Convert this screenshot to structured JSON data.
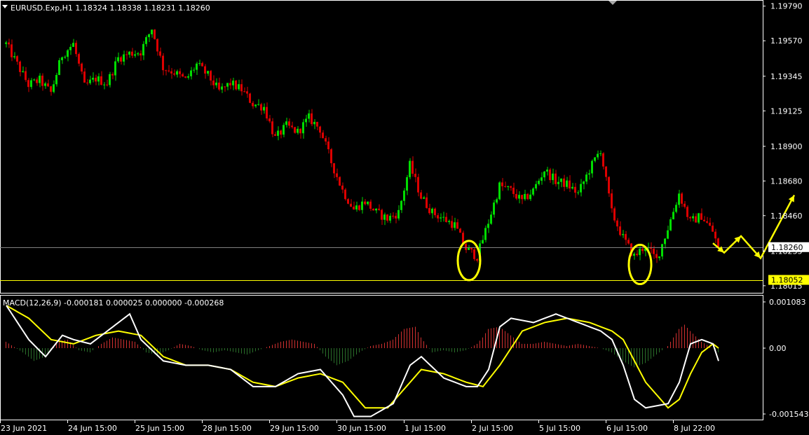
{
  "window": {
    "symbol_line": "EURUSD.Exp,H1  1.18324 1.18338 1.18231 1.18260",
    "macd_line": "MACD(12,26,9) -0.000181 0.000025 0.000000 -0.000268"
  },
  "colors": {
    "background": "#000000",
    "border": "#ffffff",
    "bull": "#00dd00",
    "bear": "#dd0000",
    "macd_main": "#ffffff",
    "macd_signal": "#ffff00",
    "hist_pos": "#d03030",
    "hist_neg": "#2a6e2a",
    "annotation": "#ffff00",
    "bid_line": "#808080",
    "support_line": "#ffff00"
  },
  "chart_data": [
    {
      "type": "candlestick",
      "title": "EURUSD.Exp,H1",
      "ohlc_last": {
        "open": 1.18324,
        "high": 1.18338,
        "low": 1.18231,
        "close": 1.1826
      },
      "ylim": [
        1.1797,
        1.1982
      ],
      "y_ticks": [
        "1.19790",
        "1.19570",
        "1.19345",
        "1.19125",
        "1.18900",
        "1.18680",
        "1.18460",
        "1.18235",
        "1.18015"
      ],
      "x_ticks": [
        "23 Jun 2021",
        "24 Jun 15:00",
        "25 Jun 15:00",
        "28 Jun 15:00",
        "29 Jun 15:00",
        "30 Jun 15:00",
        "1 Jul 15:00",
        "2 Jul 15:00",
        "5 Jul 15:00",
        "6 Jul 15:00",
        "8 Jul 22:00"
      ],
      "price_labels": {
        "bid": "1.18260",
        "support": "1.18052"
      },
      "horizontal_lines": [
        {
          "name": "bid",
          "value": 1.1826
        },
        {
          "name": "support",
          "value": 1.18052
        }
      ],
      "path": [
        [
          0,
          1.1955
        ],
        [
          4,
          1.1942
        ],
        [
          8,
          1.1929
        ],
        [
          12,
          1.1932
        ],
        [
          16,
          1.1924
        ],
        [
          20,
          1.1948
        ],
        [
          24,
          1.1955
        ],
        [
          28,
          1.1928
        ],
        [
          32,
          1.1933
        ],
        [
          36,
          1.193
        ],
        [
          40,
          1.1946
        ],
        [
          44,
          1.1949
        ],
        [
          48,
          1.195
        ],
        [
          52,
          1.1965
        ],
        [
          56,
          1.194
        ],
        [
          60,
          1.1937
        ],
        [
          64,
          1.1932
        ],
        [
          68,
          1.1942
        ],
        [
          72,
          1.1935
        ],
        [
          76,
          1.1925
        ],
        [
          80,
          1.193
        ],
        [
          84,
          1.1926
        ],
        [
          88,
          1.1917
        ],
        [
          92,
          1.1915
        ],
        [
          96,
          1.1895
        ],
        [
          100,
          1.1903
        ],
        [
          104,
          1.1899
        ],
        [
          108,
          1.1908
        ],
        [
          112,
          1.1901
        ],
        [
          116,
          1.188
        ],
        [
          120,
          1.1862
        ],
        [
          124,
          1.185
        ],
        [
          128,
          1.1855
        ],
        [
          132,
          1.1848
        ],
        [
          136,
          1.1844
        ],
        [
          140,
          1.1848
        ],
        [
          144,
          1.1878
        ],
        [
          148,
          1.1858
        ],
        [
          152,
          1.1848
        ],
        [
          156,
          1.1844
        ],
        [
          160,
          1.184
        ],
        [
          164,
          1.1825
        ],
        [
          168,
          1.182
        ],
        [
          172,
          1.1842
        ],
        [
          176,
          1.1865
        ],
        [
          180,
          1.1862
        ],
        [
          184,
          1.1855
        ],
        [
          188,
          1.1862
        ],
        [
          192,
          1.1875
        ],
        [
          196,
          1.1868
        ],
        [
          200,
          1.1866
        ],
        [
          204,
          1.186
        ],
        [
          208,
          1.1875
        ],
        [
          212,
          1.1888
        ],
        [
          216,
          1.1848
        ],
        [
          220,
          1.1832
        ],
        [
          224,
          1.182
        ],
        [
          228,
          1.1827
        ],
        [
          232,
          1.1818
        ],
        [
          236,
          1.1838
        ],
        [
          240,
          1.186
        ],
        [
          244,
          1.1842
        ],
        [
          248,
          1.1846
        ],
        [
          252,
          1.1836
        ],
        [
          254,
          1.1826
        ]
      ],
      "annotations": {
        "circles": [
          {
            "x": 165,
            "y": 1.18175
          },
          {
            "x": 226,
            "y": 1.1815
          }
        ],
        "forecast_arrows": [
          {
            "x": 252,
            "y": 1.18285
          },
          {
            "x": 256,
            "y": 1.18225
          },
          {
            "x": 262,
            "y": 1.1833
          },
          {
            "x": 269,
            "y": 1.1819
          },
          {
            "x": 281,
            "y": 1.1859
          }
        ]
      }
    },
    {
      "type": "macd",
      "title": "MACD(12,26,9)",
      "values": {
        "main": -0.000181,
        "signal": 2.5e-05,
        "histogram": 0.0,
        "extra": -0.000268
      },
      "ylim": [
        -0.001543,
        0.001083
      ],
      "y_ticks": [
        "0.001083",
        "0.00",
        "-0.001543"
      ],
      "main": [
        [
          0,
          0.001
        ],
        [
          8,
          0.0002
        ],
        [
          14,
          -0.0002
        ],
        [
          20,
          0.0003
        ],
        [
          24,
          0.0002
        ],
        [
          30,
          0.0001
        ],
        [
          36,
          0.0004
        ],
        [
          44,
          0.0008
        ],
        [
          48,
          0.0002
        ],
        [
          56,
          -0.0003
        ],
        [
          64,
          -0.0004
        ],
        [
          72,
          -0.0004
        ],
        [
          80,
          -0.0005
        ],
        [
          88,
          -0.0009
        ],
        [
          96,
          -0.0009
        ],
        [
          104,
          -0.0006
        ],
        [
          112,
          -0.0005
        ],
        [
          120,
          -0.0011
        ],
        [
          124,
          -0.0016
        ],
        [
          130,
          -0.0016
        ],
        [
          138,
          -0.0013
        ],
        [
          144,
          -0.0004
        ],
        [
          148,
          -0.0002
        ],
        [
          156,
          -0.0007
        ],
        [
          164,
          -0.0009
        ],
        [
          168,
          -0.0009
        ],
        [
          172,
          -0.0005
        ],
        [
          176,
          0.0005
        ],
        [
          180,
          0.0007
        ],
        [
          188,
          0.0006
        ],
        [
          196,
          0.0008
        ],
        [
          204,
          0.0006
        ],
        [
          212,
          0.0004
        ],
        [
          216,
          0.0002
        ],
        [
          220,
          -0.0004
        ],
        [
          224,
          -0.0012
        ],
        [
          228,
          -0.0014
        ],
        [
          236,
          -0.0013
        ],
        [
          240,
          -0.0008
        ],
        [
          244,
          0.0001
        ],
        [
          248,
          0.0002
        ],
        [
          252,
          0.0001
        ],
        [
          254,
          -0.0003
        ]
      ],
      "signal": [
        [
          0,
          0.001
        ],
        [
          8,
          0.0007
        ],
        [
          16,
          0.0002
        ],
        [
          24,
          0.0001
        ],
        [
          32,
          0.0003
        ],
        [
          40,
          0.0004
        ],
        [
          48,
          0.0003
        ],
        [
          56,
          -0.0002
        ],
        [
          64,
          -0.0004
        ],
        [
          72,
          -0.0004
        ],
        [
          80,
          -0.0005
        ],
        [
          88,
          -0.0008
        ],
        [
          96,
          -0.0009
        ],
        [
          104,
          -0.0007
        ],
        [
          112,
          -0.0006
        ],
        [
          120,
          -0.0008
        ],
        [
          128,
          -0.0014
        ],
        [
          136,
          -0.0014
        ],
        [
          140,
          -0.0011
        ],
        [
          148,
          -0.0005
        ],
        [
          156,
          -0.0006
        ],
        [
          164,
          -0.0008
        ],
        [
          170,
          -0.0009
        ],
        [
          176,
          -0.0004
        ],
        [
          184,
          0.0004
        ],
        [
          192,
          0.0006
        ],
        [
          200,
          0.0007
        ],
        [
          208,
          0.0006
        ],
        [
          216,
          0.0004
        ],
        [
          220,
          0.0002
        ],
        [
          228,
          -0.0008
        ],
        [
          236,
          -0.0014
        ],
        [
          240,
          -0.0012
        ],
        [
          244,
          -0.0006
        ],
        [
          248,
          -0.0001
        ],
        [
          252,
          0.0001
        ],
        [
          254,
          0.0
        ]
      ],
      "histogram": [
        [
          0,
          0.00015
        ],
        [
          6,
          -0.0001
        ],
        [
          10,
          -0.0003
        ],
        [
          14,
          -0.0002
        ],
        [
          18,
          0.00015
        ],
        [
          22,
          0.0002
        ],
        [
          26,
          -5e-05
        ],
        [
          30,
          -0.0001
        ],
        [
          34,
          0.0001
        ],
        [
          38,
          0.00025
        ],
        [
          42,
          0.0002
        ],
        [
          46,
          0.00015
        ],
        [
          50,
          -0.0001
        ],
        [
          54,
          -0.00015
        ],
        [
          58,
          -5e-05
        ],
        [
          62,
          0.0001
        ],
        [
          66,
          5e-05
        ],
        [
          70,
          -5e-05
        ],
        [
          74,
          -0.0001
        ],
        [
          78,
          -5e-05
        ],
        [
          82,
          -0.0001
        ],
        [
          86,
          -0.00015
        ],
        [
          90,
          -5e-05
        ],
        [
          94,
          5e-05
        ],
        [
          98,
          0.00015
        ],
        [
          102,
          0.0002
        ],
        [
          106,
          0.00015
        ],
        [
          110,
          0.0001
        ],
        [
          114,
          -0.0002
        ],
        [
          118,
          -0.0004
        ],
        [
          122,
          -0.0003
        ],
        [
          126,
          -0.0001
        ],
        [
          130,
          5e-05
        ],
        [
          134,
          0.0001
        ],
        [
          138,
          0.0002
        ],
        [
          142,
          0.00045
        ],
        [
          146,
          0.0005
        ],
        [
          148,
          0.00025
        ],
        [
          152,
          -0.0001
        ],
        [
          156,
          -5e-05
        ],
        [
          160,
          -0.0001
        ],
        [
          164,
          -5e-05
        ],
        [
          168,
          0.0001
        ],
        [
          170,
          0.00025
        ],
        [
          172,
          0.00045
        ],
        [
          176,
          0.0005
        ],
        [
          180,
          0.0003
        ],
        [
          184,
          0.0001
        ],
        [
          188,
          0.0001
        ],
        [
          192,
          0.00015
        ],
        [
          196,
          0.0001
        ],
        [
          200,
          5e-05
        ],
        [
          204,
          0.0001
        ],
        [
          208,
          5e-05
        ],
        [
          212,
          0.0
        ],
        [
          216,
          -0.0001
        ],
        [
          220,
          -0.0003
        ],
        [
          224,
          -0.00045
        ],
        [
          228,
          -0.00035
        ],
        [
          232,
          -0.00015
        ],
        [
          236,
          5e-05
        ],
        [
          240,
          0.00045
        ],
        [
          242,
          0.00055
        ],
        [
          244,
          0.0004
        ],
        [
          248,
          0.00015
        ],
        [
          252,
          0.0
        ],
        [
          254,
          -0.0001
        ]
      ]
    }
  ]
}
